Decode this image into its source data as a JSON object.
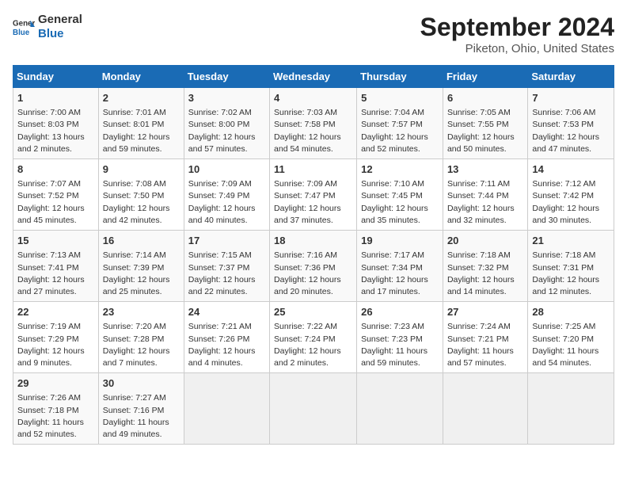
{
  "logo": {
    "line1": "General",
    "line2": "Blue"
  },
  "title": "September 2024",
  "location": "Piketon, Ohio, United States",
  "days_of_week": [
    "Sunday",
    "Monday",
    "Tuesday",
    "Wednesday",
    "Thursday",
    "Friday",
    "Saturday"
  ],
  "weeks": [
    [
      {
        "day": "1",
        "text": "Sunrise: 7:00 AM\nSunset: 8:03 PM\nDaylight: 13 hours\nand 2 minutes."
      },
      {
        "day": "2",
        "text": "Sunrise: 7:01 AM\nSunset: 8:01 PM\nDaylight: 12 hours\nand 59 minutes."
      },
      {
        "day": "3",
        "text": "Sunrise: 7:02 AM\nSunset: 8:00 PM\nDaylight: 12 hours\nand 57 minutes."
      },
      {
        "day": "4",
        "text": "Sunrise: 7:03 AM\nSunset: 7:58 PM\nDaylight: 12 hours\nand 54 minutes."
      },
      {
        "day": "5",
        "text": "Sunrise: 7:04 AM\nSunset: 7:57 PM\nDaylight: 12 hours\nand 52 minutes."
      },
      {
        "day": "6",
        "text": "Sunrise: 7:05 AM\nSunset: 7:55 PM\nDaylight: 12 hours\nand 50 minutes."
      },
      {
        "day": "7",
        "text": "Sunrise: 7:06 AM\nSunset: 7:53 PM\nDaylight: 12 hours\nand 47 minutes."
      }
    ],
    [
      {
        "day": "8",
        "text": "Sunrise: 7:07 AM\nSunset: 7:52 PM\nDaylight: 12 hours\nand 45 minutes."
      },
      {
        "day": "9",
        "text": "Sunrise: 7:08 AM\nSunset: 7:50 PM\nDaylight: 12 hours\nand 42 minutes."
      },
      {
        "day": "10",
        "text": "Sunrise: 7:09 AM\nSunset: 7:49 PM\nDaylight: 12 hours\nand 40 minutes."
      },
      {
        "day": "11",
        "text": "Sunrise: 7:09 AM\nSunset: 7:47 PM\nDaylight: 12 hours\nand 37 minutes."
      },
      {
        "day": "12",
        "text": "Sunrise: 7:10 AM\nSunset: 7:45 PM\nDaylight: 12 hours\nand 35 minutes."
      },
      {
        "day": "13",
        "text": "Sunrise: 7:11 AM\nSunset: 7:44 PM\nDaylight: 12 hours\nand 32 minutes."
      },
      {
        "day": "14",
        "text": "Sunrise: 7:12 AM\nSunset: 7:42 PM\nDaylight: 12 hours\nand 30 minutes."
      }
    ],
    [
      {
        "day": "15",
        "text": "Sunrise: 7:13 AM\nSunset: 7:41 PM\nDaylight: 12 hours\nand 27 minutes."
      },
      {
        "day": "16",
        "text": "Sunrise: 7:14 AM\nSunset: 7:39 PM\nDaylight: 12 hours\nand 25 minutes."
      },
      {
        "day": "17",
        "text": "Sunrise: 7:15 AM\nSunset: 7:37 PM\nDaylight: 12 hours\nand 22 minutes."
      },
      {
        "day": "18",
        "text": "Sunrise: 7:16 AM\nSunset: 7:36 PM\nDaylight: 12 hours\nand 20 minutes."
      },
      {
        "day": "19",
        "text": "Sunrise: 7:17 AM\nSunset: 7:34 PM\nDaylight: 12 hours\nand 17 minutes."
      },
      {
        "day": "20",
        "text": "Sunrise: 7:18 AM\nSunset: 7:32 PM\nDaylight: 12 hours\nand 14 minutes."
      },
      {
        "day": "21",
        "text": "Sunrise: 7:18 AM\nSunset: 7:31 PM\nDaylight: 12 hours\nand 12 minutes."
      }
    ],
    [
      {
        "day": "22",
        "text": "Sunrise: 7:19 AM\nSunset: 7:29 PM\nDaylight: 12 hours\nand 9 minutes."
      },
      {
        "day": "23",
        "text": "Sunrise: 7:20 AM\nSunset: 7:28 PM\nDaylight: 12 hours\nand 7 minutes."
      },
      {
        "day": "24",
        "text": "Sunrise: 7:21 AM\nSunset: 7:26 PM\nDaylight: 12 hours\nand 4 minutes."
      },
      {
        "day": "25",
        "text": "Sunrise: 7:22 AM\nSunset: 7:24 PM\nDaylight: 12 hours\nand 2 minutes."
      },
      {
        "day": "26",
        "text": "Sunrise: 7:23 AM\nSunset: 7:23 PM\nDaylight: 11 hours\nand 59 minutes."
      },
      {
        "day": "27",
        "text": "Sunrise: 7:24 AM\nSunset: 7:21 PM\nDaylight: 11 hours\nand 57 minutes."
      },
      {
        "day": "28",
        "text": "Sunrise: 7:25 AM\nSunset: 7:20 PM\nDaylight: 11 hours\nand 54 minutes."
      }
    ],
    [
      {
        "day": "29",
        "text": "Sunrise: 7:26 AM\nSunset: 7:18 PM\nDaylight: 11 hours\nand 52 minutes."
      },
      {
        "day": "30",
        "text": "Sunrise: 7:27 AM\nSunset: 7:16 PM\nDaylight: 11 hours\nand 49 minutes."
      },
      {
        "day": "",
        "text": ""
      },
      {
        "day": "",
        "text": ""
      },
      {
        "day": "",
        "text": ""
      },
      {
        "day": "",
        "text": ""
      },
      {
        "day": "",
        "text": ""
      }
    ]
  ]
}
